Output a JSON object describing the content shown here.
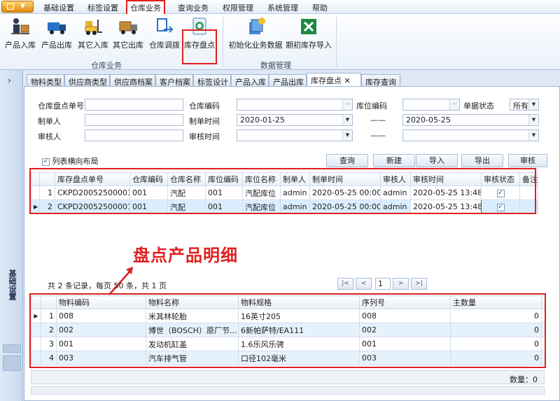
{
  "menu": {
    "items": [
      "基础设置",
      "标签设置",
      "仓库业务",
      "查询业务",
      "权限管理",
      "系统管理",
      "帮助"
    ],
    "active": "仓库业务"
  },
  "ribbon": {
    "group1": {
      "label": "仓库业务",
      "buttons": [
        "产品入库",
        "产品出库",
        "其它入库",
        "其它出库",
        "仓库调拨",
        "库存盘点"
      ]
    },
    "group2": {
      "label": "数据管理",
      "buttons": [
        "初始化业务数据",
        "期初库存导入"
      ]
    },
    "highlight": "库存盘点"
  },
  "left_panel": {
    "label": "基础设置"
  },
  "tabs": [
    "物料类型",
    "供应商类型",
    "供应商档案",
    "客户档案",
    "标签设计",
    "产品入库",
    "产品出库",
    "库存盘点",
    "库存查询"
  ],
  "active_tab": "库存盘点",
  "filters": {
    "check_no_label": "仓库盘点单号",
    "check_no": "",
    "warehouse_code_label": "仓库编码",
    "warehouse_code": "",
    "location_code_label": "库位编码",
    "location_code": "",
    "status_label": "单据状态",
    "status": "所有",
    "creator_label": "制单人",
    "creator": "",
    "create_time_label": "制单时间",
    "create_time_from": "2020-01-25",
    "create_time_to": "2020-05-25",
    "reviewer_label": "审核人",
    "reviewer": "",
    "review_time_label": "审核时间",
    "review_time_from": "",
    "review_time_to": "",
    "range_sep": "——"
  },
  "toolbar": {
    "layout_label": "列表横向布局",
    "query": "查询",
    "new": "新建",
    "import": "导入",
    "export": "导出",
    "review": "审核"
  },
  "grid1": {
    "headers": [
      "库存盘点单号",
      "仓库编码",
      "仓库名称",
      "库位编码",
      "库位名称",
      "制单人",
      "制单时间",
      "审核人",
      "审核时间",
      "审核状态",
      "备注"
    ],
    "rows": [
      {
        "no": "1",
        "code": "CKPD20052500003",
        "wh_code": "001",
        "wh_name": "汽配",
        "loc_code": "001",
        "loc_name": "汽配库位",
        "creator": "admin",
        "ctime": "2020-05-25 00:00",
        "reviewer": "admin",
        "rtime": "2020-05-25 13:48",
        "checked": "✓"
      },
      {
        "no": "2",
        "code": "CKPD20052500001",
        "wh_code": "001",
        "wh_name": "汽配",
        "loc_code": "001",
        "loc_name": "汽配库位",
        "creator": "admin",
        "ctime": "2020-05-25 00:00",
        "reviewer": "admin",
        "rtime": "2020-05-25 13:48",
        "checked": "✓"
      }
    ]
  },
  "pager": {
    "summary": "共 2 条记录，每页 50 条，共 1 页",
    "page": "1",
    "first": "|<",
    "prev": "<",
    "next": ">",
    "last": ">|"
  },
  "annotation": "盘点产品明细",
  "grid2": {
    "headers": [
      "物料编码",
      "物料名称",
      "物料规格",
      "序列号",
      "主数量"
    ],
    "rows": [
      {
        "no": "1",
        "code": "008",
        "name": "米其林轮胎",
        "spec": "16英寸205",
        "serial": "008",
        "qty": "0"
      },
      {
        "no": "2",
        "code": "002",
        "name": "博世（BOSCH）原厂节...",
        "spec": "6新帕萨特/EA111",
        "serial": "002",
        "qty": "0"
      },
      {
        "no": "3",
        "code": "001",
        "name": "发动机缸盖",
        "spec": "1.6乐风乐骋",
        "serial": "001",
        "qty": "0"
      },
      {
        "no": "4",
        "code": "003",
        "name": "汽车排气管",
        "spec": "口径102毫米",
        "serial": "003",
        "qty": "0"
      }
    ]
  },
  "footer": {
    "qty_label": "数量：0"
  },
  "colors": {
    "highlight": "#e02020",
    "ribbon_bg": "#eaf1fa",
    "accent": "#1e3c6e"
  }
}
